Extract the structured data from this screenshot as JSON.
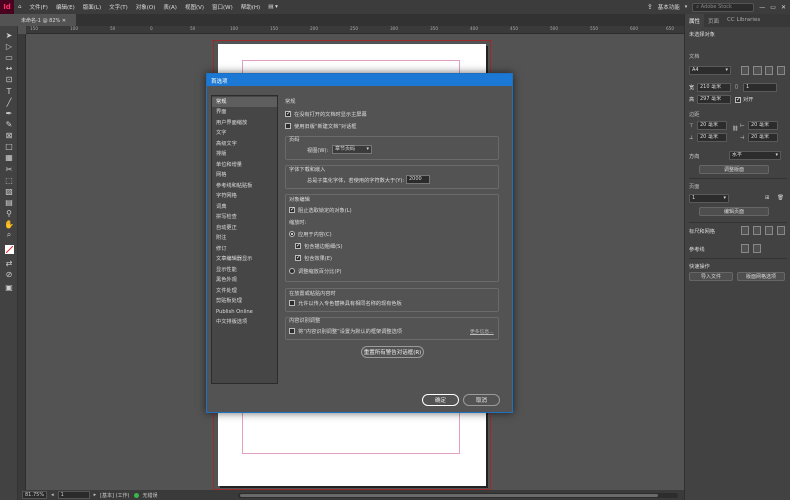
{
  "app": {
    "logo": "Id",
    "menus": [
      "文件(F)",
      "编辑(E)",
      "版面(L)",
      "文字(T)",
      "对象(O)",
      "表(A)",
      "视图(V)",
      "窗口(W)",
      "帮助(H)"
    ],
    "workspace": "基本功能",
    "search_placeholder": "Adobe Stock"
  },
  "document": {
    "tab_title": "未命名-1 @ 82%",
    "ruler_ticks": [
      "150",
      "100",
      "50",
      "0",
      "50",
      "100",
      "150",
      "200",
      "250",
      "300",
      "350",
      "400",
      "450",
      "500",
      "550",
      "600",
      "650"
    ]
  },
  "status": {
    "zoom": "81.75%",
    "page": "1",
    "style": "[基本] (工作)",
    "errors": "无错误"
  },
  "panel": {
    "tabs": [
      "属性",
      "页面",
      "CC Libraries"
    ],
    "no_selection": "未选择对象",
    "document_label": "文档",
    "page_size": "A4",
    "width_label": "宽",
    "width_value": "210 毫米",
    "height_label": "高",
    "height_value": "297 毫米",
    "pages_value": "1",
    "facing_label": "对开",
    "margins_label": "边距",
    "margin_value": "20 毫米",
    "orientation_label": "方向",
    "orientation_value": "水平",
    "adjust_layout_btn": "调整版面",
    "page_label": "页面",
    "page_value": "1",
    "edit_page_btn": "编辑页面",
    "ruler_grid_label": "标尺和网格",
    "guides_label": "参考线",
    "quick_actions_label": "快速操作",
    "import_file_btn": "导入文件",
    "layout_grid_btn": "版面网格选项"
  },
  "dialog": {
    "title": "首选项",
    "categories": [
      "常规",
      "界面",
      "用户界面缩放",
      "文字",
      "高级文字",
      "排版",
      "单位和增量",
      "网格",
      "参考线和粘贴板",
      "字符网格",
      "词典",
      "拼写检查",
      "自动更正",
      "附注",
      "修订",
      "文章编辑器显示",
      "显示性能",
      "黑色外观",
      "文件处理",
      "剪贴板处理",
      "Publish Online",
      "中文排版选项"
    ],
    "section_title": "常规",
    "opt_show_home": "在没有打开的文档时显示主屏幕",
    "opt_legacy_new": "使用旧版“新建文档”对话框",
    "page_numbering_group": "页码",
    "view_label": "视图(W):",
    "view_value": "章节页码",
    "font_download_group": "字体下载和嵌入",
    "font_subset_label": "总是子集化字体，若使用的字符数大于(Y):",
    "font_subset_value": "2000",
    "object_edit_group": "对象编辑",
    "prevent_locked": "阻止选取锁定的对象(L)",
    "scale_label": "缩放时:",
    "apply_to_content": "应用于内容(C)",
    "include_stroke": "包含描边粗细(S)",
    "include_effects": "包含效果(E)",
    "adjust_scale_pct": "调整缩放百分比(P)",
    "clipboard_group": "在放置或粘贴内容时",
    "allow_replace_swatch": "允许以传入专色替换具有相同名称的现有色板",
    "content_adjust_group": "内容识别调整",
    "content_adjust_opt": "将“内容识别调整”设置为默认的框架调整选项",
    "more_info": "更多信息...",
    "reset_warnings": "重置所有警告对话框(R)",
    "ok": "确定",
    "cancel": "取消"
  },
  "colors": {
    "accent": "#1b78d4",
    "brand": "#49021f"
  }
}
